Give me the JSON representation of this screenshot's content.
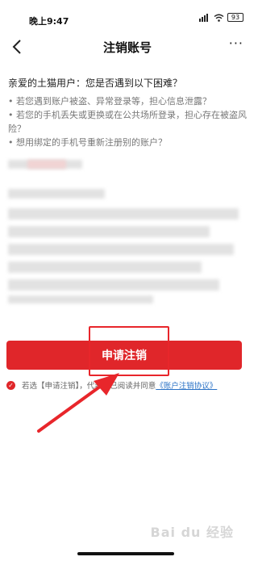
{
  "status_bar": {
    "time": "晚上9:47",
    "signal_icon": "signal-icon",
    "wifi_icon": "wifi-icon",
    "battery": "93"
  },
  "nav": {
    "title": "注销账号",
    "back_icon": "chevron-left-icon",
    "more_label": "···"
  },
  "intro": {
    "title": "亲爱的土猫用户：您是否遇到以下困难？",
    "items": [
      "• 若您遇到账户被盗、异常登录等，担心信息泄露？",
      "• 若您的手机丢失或更换或在公共场所登录，担心存在被盗风险？",
      "• 想用绑定的手机号重新注册别的账户？"
    ]
  },
  "apply_button": {
    "label": "申请注销"
  },
  "agreement": {
    "text": "若选【申请注销】，代表您已阅读并同意",
    "link": "《账户注销协议》",
    "check_icon": "check-icon"
  },
  "watermark": "Bai du 经验",
  "colors": {
    "accent": "#e0262a",
    "link": "#2a72c6",
    "annotation": "#e8262b"
  }
}
